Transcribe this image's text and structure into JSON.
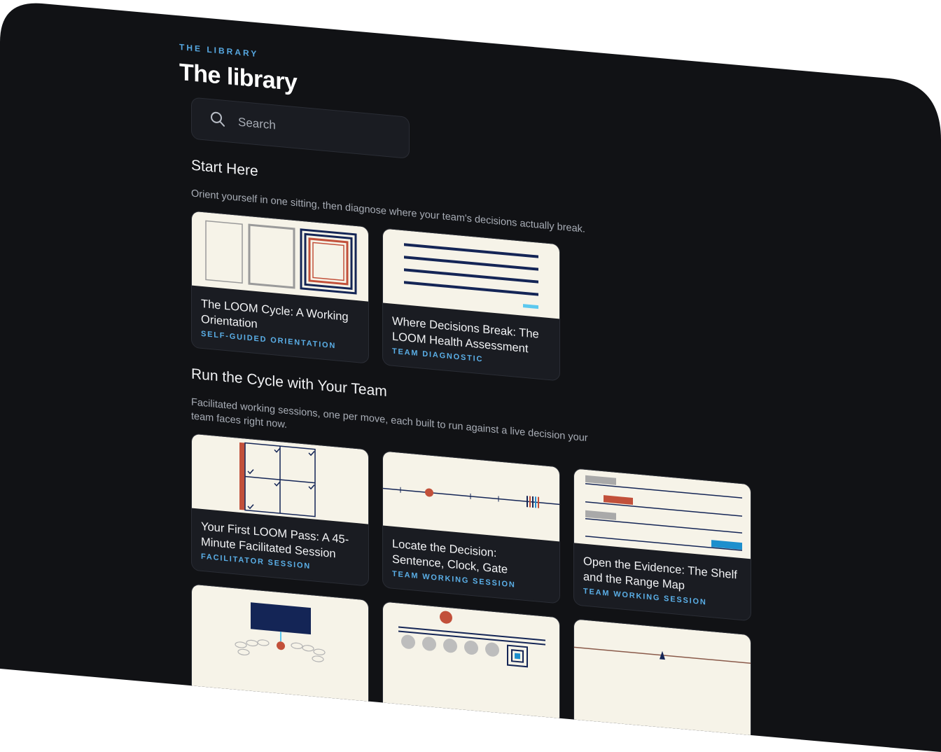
{
  "header": {
    "eyebrow": "THE LIBRARY",
    "title": "The library"
  },
  "search": {
    "placeholder": "Search"
  },
  "sections": [
    {
      "title": "Start Here",
      "description": "Orient yourself in one sitting, then diagnose where your team's decisions actually break.",
      "cards": [
        {
          "title": "The LOOM Cycle: A Working Orientation",
          "tag": "SELF-GUIDED ORIENTATION"
        },
        {
          "title": "Where Decisions Break: The LOOM Health Assessment",
          "tag": "TEAM DIAGNOSTIC"
        }
      ]
    },
    {
      "title": "Run the Cycle with Your Team",
      "description": "Facilitated working sessions, one per move, each built to run against a live decision your team faces right now.",
      "cards": [
        {
          "title": "Your First LOOM Pass: A 45-Minute Facilitated Session",
          "tag": "FACILITATOR SESSION"
        },
        {
          "title": "Locate the Decision: Sentence, Clock, Gate",
          "tag": "TEAM WORKING SESSION"
        },
        {
          "title": "Open the Evidence: The Shelf and the Range Map",
          "tag": "TEAM WORKING SESSION"
        }
      ]
    }
  ],
  "colors": {
    "background": "#111215",
    "card": "#1a1c22",
    "thumb": "#f6f3e8",
    "accent": "#5aaee6",
    "navy": "#142556",
    "rust": "#c2503a"
  }
}
